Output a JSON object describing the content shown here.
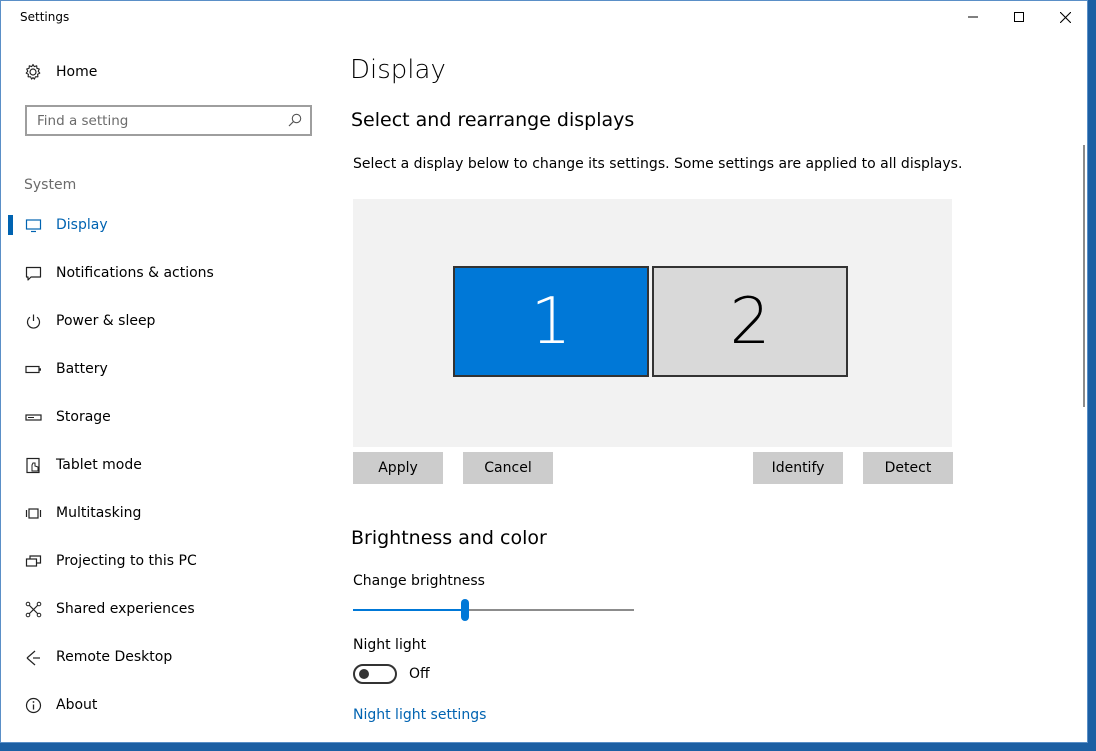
{
  "window": {
    "title": "Settings"
  },
  "sidebar": {
    "home_label": "Home",
    "search_placeholder": "Find a setting",
    "section_label": "System",
    "items": [
      {
        "label": "Display",
        "icon": "display-icon",
        "active": true
      },
      {
        "label": "Notifications & actions",
        "icon": "notifications-icon",
        "active": false
      },
      {
        "label": "Power & sleep",
        "icon": "power-icon",
        "active": false
      },
      {
        "label": "Battery",
        "icon": "battery-icon",
        "active": false
      },
      {
        "label": "Storage",
        "icon": "storage-icon",
        "active": false
      },
      {
        "label": "Tablet mode",
        "icon": "tablet-mode-icon",
        "active": false
      },
      {
        "label": "Multitasking",
        "icon": "multitasking-icon",
        "active": false
      },
      {
        "label": "Projecting to this PC",
        "icon": "projecting-icon",
        "active": false
      },
      {
        "label": "Shared experiences",
        "icon": "shared-experiences-icon",
        "active": false
      },
      {
        "label": "Remote Desktop",
        "icon": "remote-desktop-icon",
        "active": false
      },
      {
        "label": "About",
        "icon": "info-icon",
        "active": false
      }
    ]
  },
  "main": {
    "page_title": "Display",
    "arrange_heading": "Select and rearrange displays",
    "arrange_description": "Select a display below to change its settings. Some settings are applied to all displays.",
    "monitors": [
      {
        "label": "1",
        "selected": true
      },
      {
        "label": "2",
        "selected": false
      }
    ],
    "buttons": {
      "apply": "Apply",
      "cancel": "Cancel",
      "identify": "Identify",
      "detect": "Detect"
    },
    "brightness_heading": "Brightness and color",
    "brightness_label": "Change brightness",
    "brightness_value": 40,
    "night_light_label": "Night light",
    "night_light_state": "Off",
    "night_light_link": "Night light settings"
  },
  "colors": {
    "accent": "#0078d7",
    "accent_text": "#0063b1",
    "monitor_unselected": "#d9d9d9",
    "button_bg": "#cccccc"
  }
}
